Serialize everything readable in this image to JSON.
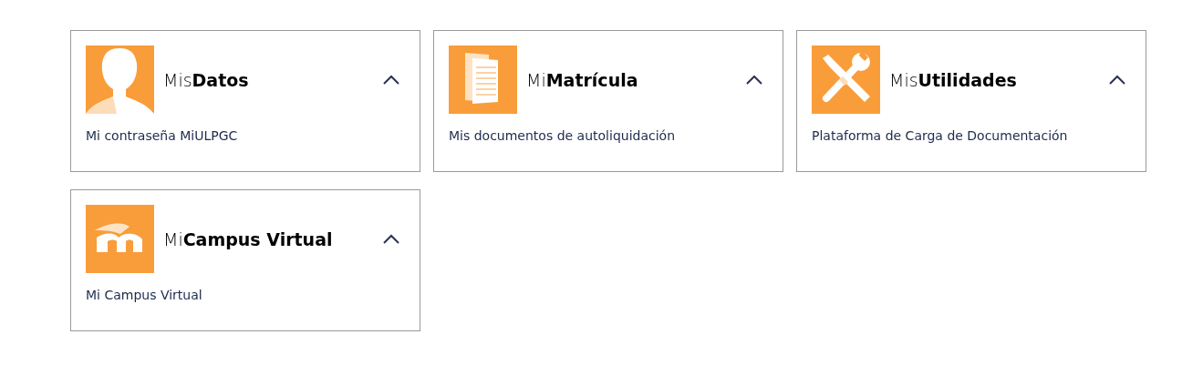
{
  "cards": [
    {
      "kind": "person",
      "title": "Mis**Datos**",
      "expanded": true,
      "links": [
        "Mi contraseña MiULPGC"
      ]
    },
    {
      "kind": "documents",
      "title": "Mi**Matrícula**",
      "expanded": true,
      "links": [
        "Mis documentos de autoliquidación"
      ]
    },
    {
      "kind": "tools",
      "title": "Mis**Utilidades**",
      "expanded": true,
      "links": [
        "Plataforma de Carga de Documentación"
      ]
    },
    {
      "kind": "campus",
      "title": "Mi**Campus Virtual**",
      "expanded": true,
      "links": [
        "Mi Campus Virtual"
      ]
    }
  ]
}
